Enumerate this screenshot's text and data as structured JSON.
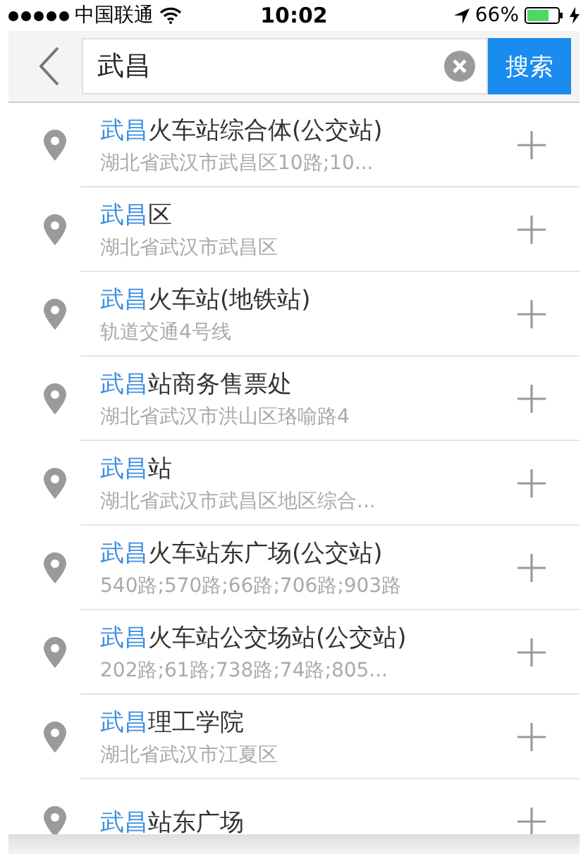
{
  "status_bar": {
    "carrier": "中国联通",
    "time": "10:02",
    "battery": "66%"
  },
  "search": {
    "value": "武昌",
    "button": "搜索"
  },
  "results": [
    {
      "highlight": "武昌",
      "rest": "火车站综合体(公交站)",
      "detail": "湖北省武汉市武昌区10路;10..."
    },
    {
      "highlight": "武昌",
      "rest": "区",
      "detail": "湖北省武汉市武昌区"
    },
    {
      "highlight": "武昌",
      "rest": "火车站(地铁站)",
      "detail": "轨道交通4号线"
    },
    {
      "highlight": "武昌",
      "rest": "站商务售票处",
      "detail": "湖北省武汉市洪山区珞喻路4"
    },
    {
      "highlight": "武昌",
      "rest": "站",
      "detail": "湖北省武汉市武昌区地区综合..."
    },
    {
      "highlight": "武昌",
      "rest": "火车站东广场(公交站)",
      "detail": "540路;570路;66路;706路;903路"
    },
    {
      "highlight": "武昌",
      "rest": "火车站公交场站(公交站)",
      "detail": "202路;61路;738路;74路;805..."
    },
    {
      "highlight": "武昌",
      "rest": "理工学院",
      "detail": "湖北省武汉市江夏区"
    },
    {
      "highlight": "武昌",
      "rest": "站东广场"
    }
  ]
}
